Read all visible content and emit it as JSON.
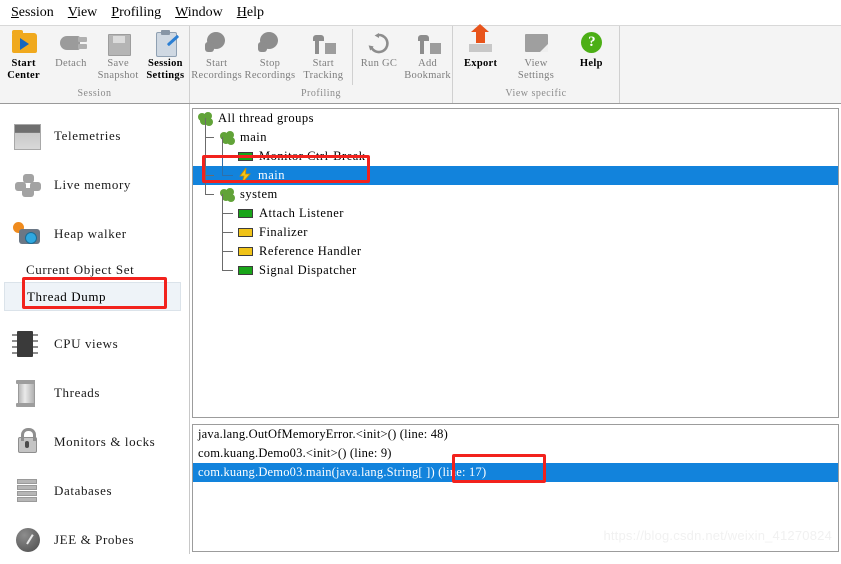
{
  "menubar": {
    "items": [
      {
        "mnemonic": "S",
        "rest": "ession"
      },
      {
        "mnemonic": "V",
        "rest": "iew"
      },
      {
        "mnemonic": "P",
        "rest": "rofiling"
      },
      {
        "mnemonic": "W",
        "rest": "indow"
      },
      {
        "mnemonic": "H",
        "rest": "elp"
      }
    ]
  },
  "ribbon": {
    "groups": [
      {
        "label": "Session",
        "buttons": [
          {
            "icon": "start-center-icon",
            "line1": "Start",
            "line2": "Center",
            "bold": true,
            "dim": false
          },
          {
            "icon": "detach-icon",
            "line1": "Detach",
            "line2": "",
            "bold": false,
            "dim": true
          },
          {
            "icon": "save-snapshot-icon",
            "line1": "Save",
            "line2": "Snapshot",
            "bold": false,
            "dim": true
          },
          {
            "icon": "session-settings-icon",
            "line1": "Session",
            "line2": "Settings",
            "bold": true,
            "dim": false
          }
        ]
      },
      {
        "label": "Profiling",
        "buttons": [
          {
            "icon": "start-recordings-icon",
            "line1": "Start",
            "line2": "Recordings",
            "bold": false,
            "dim": true
          },
          {
            "icon": "stop-recordings-icon",
            "line1": "Stop",
            "line2": "Recordings",
            "bold": false,
            "dim": true
          },
          {
            "icon": "start-tracking-icon",
            "line1": "Start",
            "line2": "Tracking",
            "bold": false,
            "dim": true
          },
          {
            "icon": "run-gc-icon",
            "line1": "Run GC",
            "line2": "",
            "bold": false,
            "dim": true
          },
          {
            "icon": "add-bookmark-icon",
            "line1": "Add",
            "line2": "Bookmark",
            "bold": false,
            "dim": true
          }
        ]
      },
      {
        "label": "View specific",
        "buttons": [
          {
            "icon": "export-icon",
            "line1": "Export",
            "line2": "",
            "bold": true,
            "dim": false
          },
          {
            "icon": "view-settings-icon",
            "line1": "View",
            "line2": "Settings",
            "bold": false,
            "dim": true
          },
          {
            "icon": "help-icon",
            "line1": "Help",
            "line2": "",
            "bold": true,
            "dim": false
          }
        ]
      }
    ]
  },
  "sidebar": {
    "items": [
      {
        "icon": "telemetries-icon",
        "label": "Telemetries"
      },
      {
        "icon": "live-memory-icon",
        "label": "Live memory"
      },
      {
        "icon": "heap-walker-icon",
        "label": "Heap walker"
      }
    ],
    "section_label": "Current Object Set",
    "sub_item": {
      "label": "Thread Dump",
      "selected": true
    },
    "items2": [
      {
        "icon": "cpu-views-icon",
        "label": "CPU views"
      },
      {
        "icon": "threads-icon",
        "label": "Threads"
      },
      {
        "icon": "monitors-locks-icon",
        "label": "Monitors & locks"
      },
      {
        "icon": "databases-icon",
        "label": "Databases"
      },
      {
        "icon": "jee-probes-icon",
        "label": "JEE & Probes"
      }
    ]
  },
  "tree": {
    "rows": [
      {
        "indent": 0,
        "icon": "thread-group-icon",
        "label": "All thread groups",
        "selected": false
      },
      {
        "indent": 1,
        "icon": "thread-group-icon",
        "label": "main",
        "selected": false
      },
      {
        "indent": 2,
        "icon": "thread-green-icon",
        "label": "Monitor Ctrl-Break",
        "selected": false
      },
      {
        "indent": 2,
        "icon": "thread-running-icon",
        "label": "main",
        "selected": true
      },
      {
        "indent": 1,
        "icon": "thread-group-icon",
        "label": "system",
        "selected": false
      },
      {
        "indent": 2,
        "icon": "thread-green-icon",
        "label": "Attach Listener",
        "selected": false
      },
      {
        "indent": 2,
        "icon": "thread-yellow-icon",
        "label": "Finalizer",
        "selected": false
      },
      {
        "indent": 2,
        "icon": "thread-yellow-icon",
        "label": "Reference Handler",
        "selected": false
      },
      {
        "indent": 2,
        "icon": "thread-green-icon",
        "label": "Signal Dispatcher",
        "selected": false
      }
    ]
  },
  "stacktrace": {
    "rows": [
      {
        "text": "java.lang.OutOfMemoryError.<init>()  (line: 48)",
        "selected": false
      },
      {
        "text": "com.kuang.Demo03.<init>()  (line: 9)",
        "selected": false
      },
      {
        "text": "com.kuang.Demo03.main(java.lang.String[ ])  (line: 17)",
        "selected": true
      }
    ]
  },
  "annotations": {
    "color": "#f2221d",
    "boxes": [
      "thread-dump-highlight",
      "main-thread-row-highlight",
      "line-number-highlight"
    ]
  },
  "watermark": {
    "text": "https://blog.csdn.net/weixin_41270824"
  }
}
